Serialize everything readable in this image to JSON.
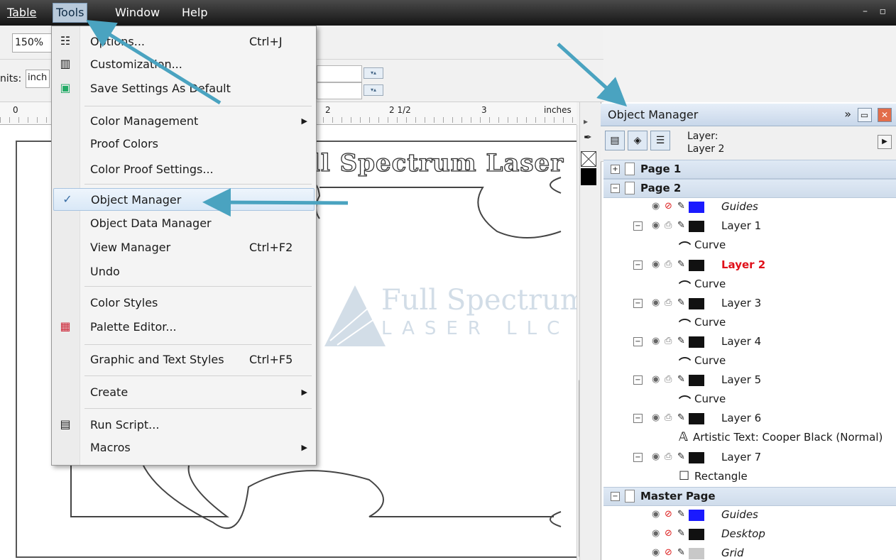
{
  "menubar": {
    "items": [
      "Table",
      "Tools",
      "Window",
      "Help"
    ],
    "window_controls": "– ▫"
  },
  "toolbar": {
    "zoom_value": "150%",
    "units_label": "nits:",
    "units_value": "inch"
  },
  "ruler": {
    "labels": [
      "0",
      "2",
      "2 1/2",
      "3",
      "inches"
    ]
  },
  "canvas": {
    "artistic_text": "ll Spectrum Laser"
  },
  "watermark": {
    "line1": "Full Spectrum",
    "line2": "LASER LLC"
  },
  "tools_menu": {
    "items": [
      {
        "label": "Options...",
        "shortcut": "Ctrl+J",
        "icon": "options-icon"
      },
      {
        "label": "Customization...",
        "shortcut": "",
        "icon": "customization-icon"
      },
      {
        "label": "Save Settings As Default",
        "shortcut": "",
        "icon": "save-settings-icon"
      },
      {
        "label": "Color Management",
        "shortcut": "",
        "submenu": true
      },
      {
        "label": "Proof Colors",
        "shortcut": ""
      },
      {
        "label": "Color Proof Settings...",
        "shortcut": ""
      },
      {
        "label": "Object Manager",
        "shortcut": "",
        "checked": true
      },
      {
        "label": "Object Data Manager",
        "shortcut": ""
      },
      {
        "label": "View Manager",
        "shortcut": "Ctrl+F2"
      },
      {
        "label": "Undo",
        "shortcut": ""
      },
      {
        "label": "Color Styles",
        "shortcut": ""
      },
      {
        "label": "Palette Editor...",
        "shortcut": "",
        "icon": "palette-editor-icon"
      },
      {
        "label": "Graphic and Text Styles",
        "shortcut": "Ctrl+F5"
      },
      {
        "label": "Create",
        "shortcut": "",
        "submenu": true
      },
      {
        "label": "Run Script...",
        "shortcut": "",
        "icon": "run-script-icon"
      },
      {
        "label": "Macros",
        "shortcut": "",
        "submenu": true
      }
    ]
  },
  "object_manager": {
    "title": "Object Manager",
    "layer_label": "Layer:",
    "current_layer": "Layer 2",
    "tree": [
      {
        "label": "Page 1",
        "type": "page"
      },
      {
        "label": "Page 2",
        "type": "page"
      },
      {
        "label": "Guides",
        "type": "guides-layer"
      },
      {
        "label": "Layer 1",
        "type": "layer"
      },
      {
        "label": "Curve",
        "type": "object"
      },
      {
        "label": "Layer 2",
        "type": "layer",
        "active": true
      },
      {
        "label": "Curve",
        "type": "object"
      },
      {
        "label": "Layer 3",
        "type": "layer"
      },
      {
        "label": "Curve",
        "type": "object"
      },
      {
        "label": "Layer 4",
        "type": "layer"
      },
      {
        "label": "Curve",
        "type": "object"
      },
      {
        "label": "Layer 5",
        "type": "layer"
      },
      {
        "label": "Curve",
        "type": "object"
      },
      {
        "label": "Layer 6",
        "type": "layer"
      },
      {
        "label": "Artistic Text: Cooper Black (Normal)",
        "type": "object"
      },
      {
        "label": "Layer 7",
        "type": "layer"
      },
      {
        "label": "Rectangle",
        "type": "object"
      },
      {
        "label": "Master Page",
        "type": "page"
      },
      {
        "label": "Guides",
        "type": "guides-layer"
      },
      {
        "label": "Desktop",
        "type": "guides-layer"
      },
      {
        "label": "Grid",
        "type": "guides-layer"
      }
    ]
  },
  "colors": {
    "guides_swatch": "#1a1aff",
    "layer_swatch": "#111111",
    "grid_swatch": "#c8c8c8",
    "active_layer_text": "#e0101a",
    "annotation_arrow": "#4aa3c0"
  }
}
